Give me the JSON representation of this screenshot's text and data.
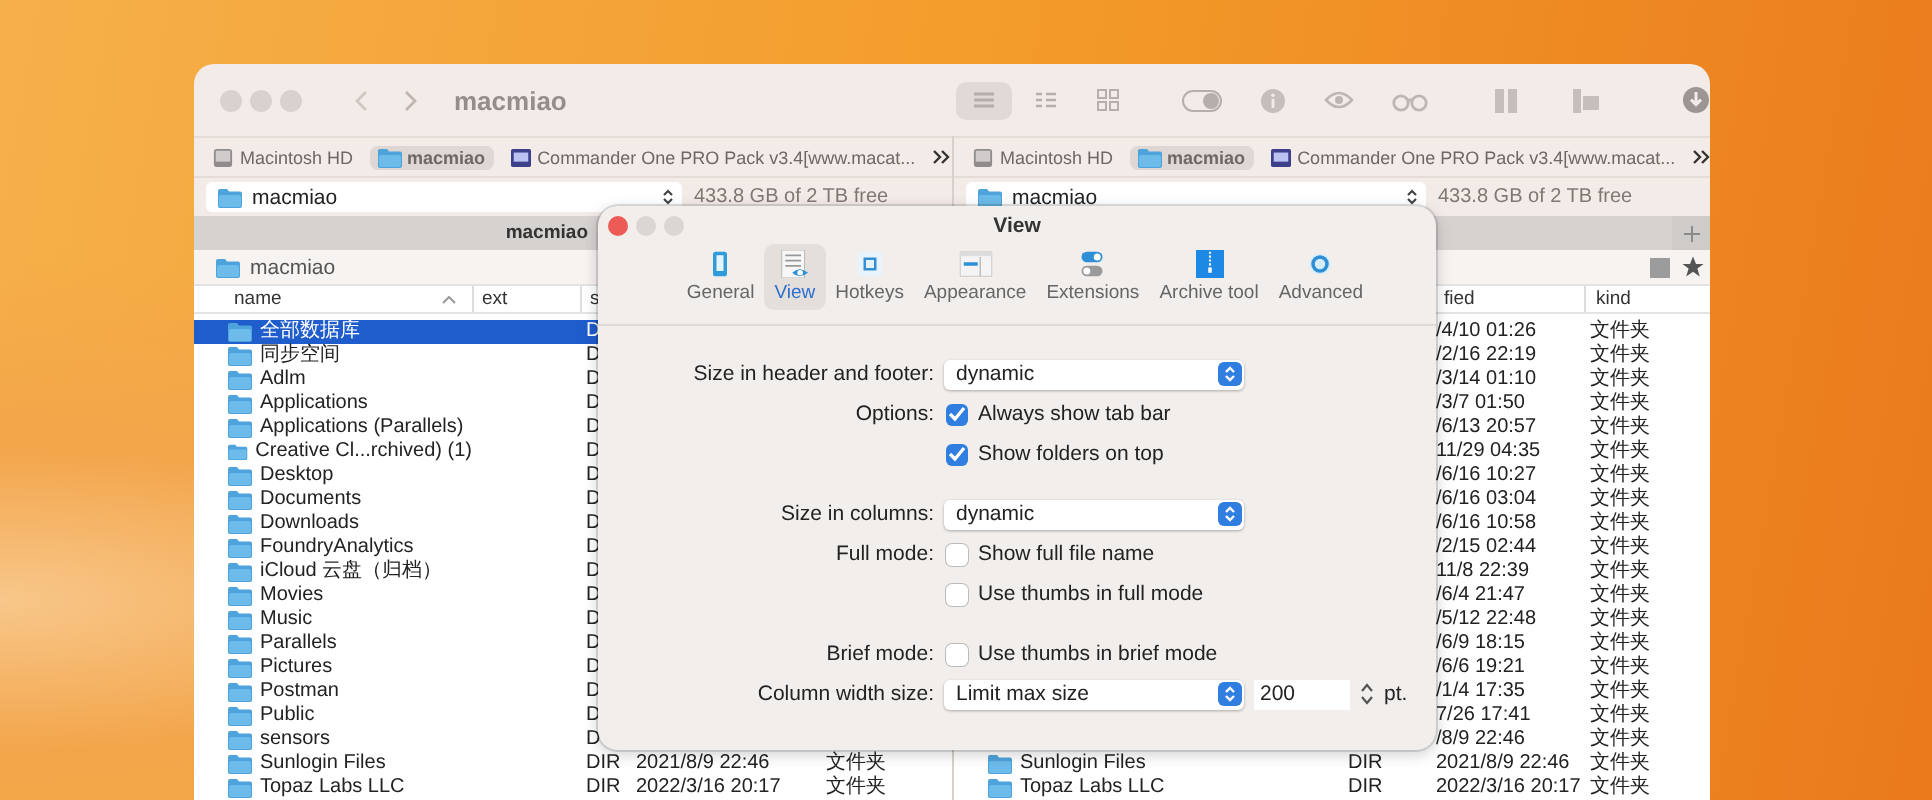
{
  "window": {
    "title": "macmiao"
  },
  "view_modes": [
    {
      "kind": "list",
      "selected": true
    },
    {
      "kind": "columns",
      "selected": false
    },
    {
      "kind": "grid",
      "selected": false
    }
  ],
  "panels": [
    {
      "drive_tabs": [
        {
          "label": "Macintosh HD",
          "selected": false
        },
        {
          "label": "macmiao",
          "selected": true
        },
        {
          "label": "Commander One PRO Pack v3.4[www.macat...",
          "selected": false
        }
      ],
      "location": "macmiao",
      "free_space": "433.8 GB of 2 TB free",
      "tab_title": "macmiao",
      "breadcrumb": "macmiao",
      "columns": [
        "name",
        "ext",
        "s"
      ],
      "rows": [
        {
          "name": "全部数据库",
          "size": "D",
          "selected": true
        },
        {
          "name": "同步空间",
          "size": "D",
          "selected": false
        },
        {
          "name": "Adlm",
          "size": "D",
          "selected": false
        },
        {
          "name": "Applications",
          "size": "D",
          "selected": false
        },
        {
          "name": "Applications (Parallels)",
          "size": "D",
          "selected": false
        },
        {
          "name": "Creative Cl...rchived) (1)",
          "size": "D",
          "selected": false
        },
        {
          "name": "Desktop",
          "size": "D",
          "selected": false
        },
        {
          "name": "Documents",
          "size": "D",
          "selected": false
        },
        {
          "name": "Downloads",
          "size": "D",
          "selected": false
        },
        {
          "name": "FoundryAnalytics",
          "size": "D",
          "selected": false
        },
        {
          "name": "iCloud 云盘（归档）",
          "size": "D",
          "selected": false
        },
        {
          "name": "Movies",
          "size": "D",
          "selected": false
        },
        {
          "name": "Music",
          "size": "D",
          "selected": false
        },
        {
          "name": "Parallels",
          "size": "D",
          "selected": false
        },
        {
          "name": "Pictures",
          "size": "D",
          "selected": false
        },
        {
          "name": "Postman",
          "size": "D",
          "selected": false
        },
        {
          "name": "Public",
          "size": "D",
          "selected": false
        },
        {
          "name": "sensors",
          "size": "D",
          "selected": false
        },
        {
          "name": "Sunlogin Files",
          "size": "DIR",
          "modified": "2021/8/9 22:46",
          "kind": "文件夹",
          "selected": false
        },
        {
          "name": "Topaz Labs LLC",
          "size": "DIR",
          "modified": "2022/3/16 20:17",
          "kind": "文件夹",
          "selected": false
        }
      ]
    },
    {
      "drive_tabs": [
        {
          "label": "Macintosh HD",
          "selected": false
        },
        {
          "label": "macmiao",
          "selected": true
        },
        {
          "label": "Commander One PRO Pack v3.4[www.macat...",
          "selected": false
        }
      ],
      "location": "macmiao",
      "free_space": "433.8 GB of 2 TB free",
      "columns": [
        "fied",
        "kind"
      ],
      "rows": [
        {
          "modified": "/4/10 01:26",
          "kind": "文件夹",
          "selected": false
        },
        {
          "modified": "/2/16 22:19",
          "kind": "文件夹",
          "selected": false
        },
        {
          "modified": "/3/14 01:10",
          "kind": "文件夹",
          "selected": false
        },
        {
          "modified": "/3/7 01:50",
          "kind": "文件夹",
          "selected": false
        },
        {
          "modified": "/6/13 20:57",
          "kind": "文件夹",
          "selected": false
        },
        {
          "modified": "11/29 04:35",
          "kind": "文件夹",
          "selected": false
        },
        {
          "modified": "/6/16 10:27",
          "kind": "文件夹",
          "selected": false
        },
        {
          "modified": "/6/16 03:04",
          "kind": "文件夹",
          "selected": false
        },
        {
          "modified": "/6/16 10:58",
          "kind": "文件夹",
          "selected": false
        },
        {
          "modified": "/2/15 02:44",
          "kind": "文件夹",
          "selected": false
        },
        {
          "modified": "11/8 22:39",
          "kind": "文件夹",
          "selected": false
        },
        {
          "modified": "/6/4 21:47",
          "kind": "文件夹",
          "selected": false
        },
        {
          "modified": "/5/12 22:48",
          "kind": "文件夹",
          "selected": false
        },
        {
          "modified": "/6/9 18:15",
          "kind": "文件夹",
          "selected": false
        },
        {
          "modified": "/6/6 19:21",
          "kind": "文件夹",
          "selected": false
        },
        {
          "modified": "/1/4 17:35",
          "kind": "文件夹",
          "selected": false
        },
        {
          "modified": "7/26 17:41",
          "kind": "文件夹",
          "selected": false
        },
        {
          "modified": "/8/9 22:46",
          "kind": "文件夹",
          "selected": false
        },
        {
          "name": "Sunlogin Files",
          "size": "DIR",
          "modified": "2021/8/9 22:46",
          "kind": "文件夹",
          "selected": false
        },
        {
          "name": "Topaz Labs LLC",
          "size": "DIR",
          "modified": "2022/3/16 20:17",
          "kind": "文件夹",
          "selected": false
        }
      ]
    }
  ],
  "dialog": {
    "title": "View",
    "tabs": [
      {
        "label": "General",
        "selected": false
      },
      {
        "label": "View",
        "selected": true
      },
      {
        "label": "Hotkeys",
        "selected": false
      },
      {
        "label": "Appearance",
        "selected": false
      },
      {
        "label": "Extensions",
        "selected": false
      },
      {
        "label": "Archive tool",
        "selected": false
      },
      {
        "label": "Advanced",
        "selected": false
      }
    ],
    "groups": [
      [
        {
          "kind": "select",
          "label": "Size in header and footer:",
          "value": "dynamic"
        },
        {
          "kind": "checkbox",
          "label": "Options:",
          "text": "Always show tab bar",
          "checked": true
        },
        {
          "kind": "checkbox",
          "text": "Show folders on top",
          "checked": true
        }
      ],
      [
        {
          "kind": "select",
          "label": "Size in columns:",
          "value": "dynamic"
        },
        {
          "kind": "checkbox",
          "label": "Full mode:",
          "text": "Show full file name",
          "checked": false
        },
        {
          "kind": "checkbox",
          "text": "Use thumbs in full mode",
          "checked": false
        }
      ],
      [
        {
          "kind": "checkbox",
          "label": "Brief mode:",
          "text": "Use thumbs in brief mode",
          "checked": false
        },
        {
          "kind": "select_number",
          "label": "Column width size:",
          "value": "Limit max size",
          "number": "200",
          "unit": "pt."
        }
      ]
    ]
  }
}
